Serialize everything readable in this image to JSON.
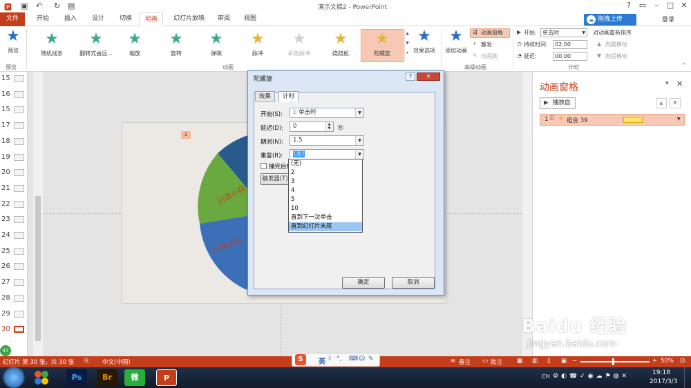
{
  "window": {
    "title": "演示文稿2 - PowerPoint",
    "login": "登录",
    "cloud_button": "拖拽上传"
  },
  "tabs": [
    "文件",
    "开始",
    "插入",
    "设计",
    "切换",
    "动画",
    "幻灯片放映",
    "审阅",
    "视图"
  ],
  "active_tab": "动画",
  "ribbon": {
    "preview_label": "预览",
    "preview_group": "预览",
    "effects": [
      {
        "label": "随机线条",
        "color": "#3aaa8c"
      },
      {
        "label": "翻转式由远...",
        "color": "#3aaa8c"
      },
      {
        "label": "缩放",
        "color": "#3aaa8c"
      },
      {
        "label": "旋转",
        "color": "#3aaa8c"
      },
      {
        "label": "弹跳",
        "color": "#3aaa8c"
      },
      {
        "label": "脉冲",
        "color": "#e5b43a"
      },
      {
        "label": "彩色脉冲",
        "color": "#cfcfcf"
      },
      {
        "label": "跷跷板",
        "color": "#e5b43a"
      },
      {
        "label": "陀螺旋",
        "color": "#e5b43a"
      }
    ],
    "effect_options": "效果选项",
    "animation_group": "动画",
    "add_animation": "添加动画",
    "animation_pane": "动画窗格",
    "trigger": "触发",
    "painter": "动画刷",
    "advanced_group": "高级动画",
    "start_label": "开始:",
    "start_value": "单击时",
    "duration_label": "持续时间:",
    "duration_value": "02.00",
    "delay_label": "延迟:",
    "delay_value": "00.00",
    "reorder_title": "对动画重新排序",
    "move_earlier": "向前移动",
    "move_later": "向后移动",
    "timing_group": "计时"
  },
  "slides": [
    "15",
    "16",
    "15",
    "17",
    "18",
    "19",
    "20",
    "21",
    "22",
    "23",
    "24",
    "25",
    "26",
    "27",
    "28",
    "29",
    "30"
  ],
  "selected_slide": "30",
  "slide": {
    "badge": "1",
    "pie_text_a": "川流小兵",
    "pie_text_b": "川流小兵"
  },
  "anim_pane": {
    "title": "动画窗格",
    "play_button": "播放自",
    "item_number": "1",
    "item_name": "组合 39"
  },
  "dialog": {
    "title": "陀螺旋",
    "tab_effect": "效果",
    "tab_timing": "计时",
    "start_label": "开始(S):",
    "start_value": "单击时",
    "delay_label": "延迟(D):",
    "delay_value": "0",
    "delay_unit": "秒",
    "duration_label": "期间(N):",
    "duration_value": "1.5",
    "repeat_label": "重复(R):",
    "repeat_value": "(无)",
    "rewind_label": "播完后快退",
    "trigger_button": "触发器(T)",
    "ok": "确定",
    "cancel": "取消",
    "repeat_options": [
      "(无)",
      "2",
      "3",
      "4",
      "5",
      "10",
      "直到下一次单击",
      "直到幻灯片末尾"
    ],
    "highlighted_option": "直到幻灯片末尾"
  },
  "statusbar": {
    "slide_info": "幻灯片 第 30 张，共 30 张",
    "language": "中文(中国)",
    "notes": "备注",
    "comments": "批注",
    "zoom": "50%",
    "page_counter": "4"
  },
  "ime": {
    "lang": "英"
  },
  "taskbar": {
    "apps": [
      {
        "label": "Ps",
        "bg": "#0b1a3f",
        "fg": "#31a8ff"
      },
      {
        "label": "Br",
        "bg": "#2a1800",
        "fg": "#e38e1b"
      },
      {
        "label": "微",
        "bg": "#2aae3b",
        "fg": "#fff"
      },
      {
        "label": "P",
        "bg": "#c43e1c",
        "fg": "#fff"
      }
    ],
    "tray_lang": "CH",
    "time": "19:18",
    "date": "2017/3/3"
  },
  "watermark": {
    "brand": "Baidu 经验",
    "url": "jingyan.baidu.com"
  },
  "colors": {
    "accent": "#c43e1c",
    "pie_blue": "#3b6fb8",
    "pie_green": "#6aa840",
    "pie_navy": "#285a8e",
    "pie_text": "#c43e1c"
  }
}
